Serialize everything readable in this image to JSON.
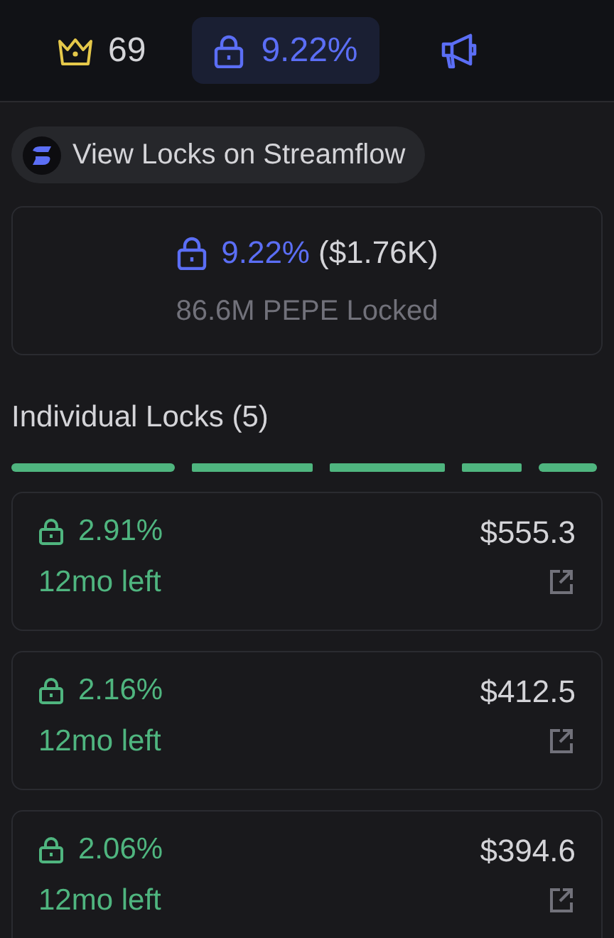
{
  "top_bar": {
    "rank": "69",
    "locked_percent": "9.22%"
  },
  "streamflow_button": {
    "label": "View Locks on Streamflow"
  },
  "summary": {
    "percent": "9.22%",
    "value": "($1.76K)",
    "amount": "86.6M PEPE Locked"
  },
  "individual_locks": {
    "heading": "Individual Locks (5)",
    "locks": [
      {
        "percent": "2.91%",
        "value": "$555.3",
        "time_left": "12mo left"
      },
      {
        "percent": "2.16%",
        "value": "$412.5",
        "time_left": "12mo left"
      },
      {
        "percent": "2.06%",
        "value": "$394.6",
        "time_left": "12mo left"
      }
    ]
  }
}
